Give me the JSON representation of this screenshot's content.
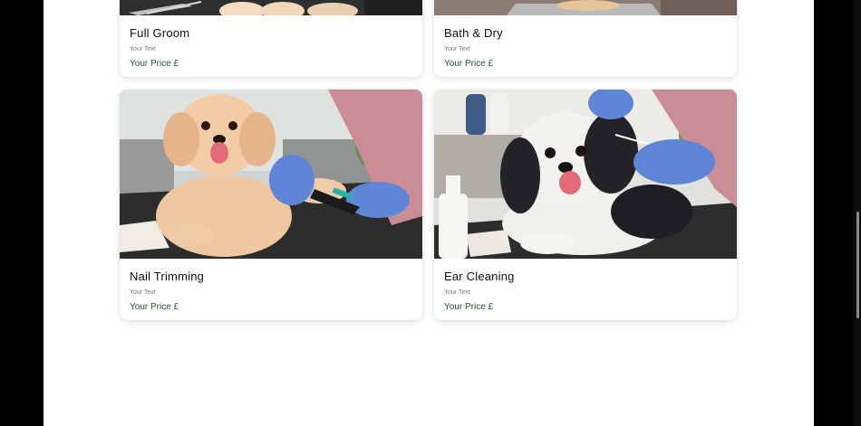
{
  "services": [
    {
      "title": "Full Groom",
      "description": "Your Text",
      "price": "Your Price £"
    },
    {
      "title": "Bath & Dry",
      "description": "Your Text",
      "price": "Your Price £"
    },
    {
      "title": "Nail Trimming",
      "description": "Your Text",
      "price": "Your Price £"
    },
    {
      "title": "Ear Cleaning",
      "description": "Your Text",
      "price": "Your Price £"
    }
  ],
  "colors": {
    "price_text": "#1d5b2a",
    "page_background": "#ffffff",
    "outer_background": "#000000"
  }
}
